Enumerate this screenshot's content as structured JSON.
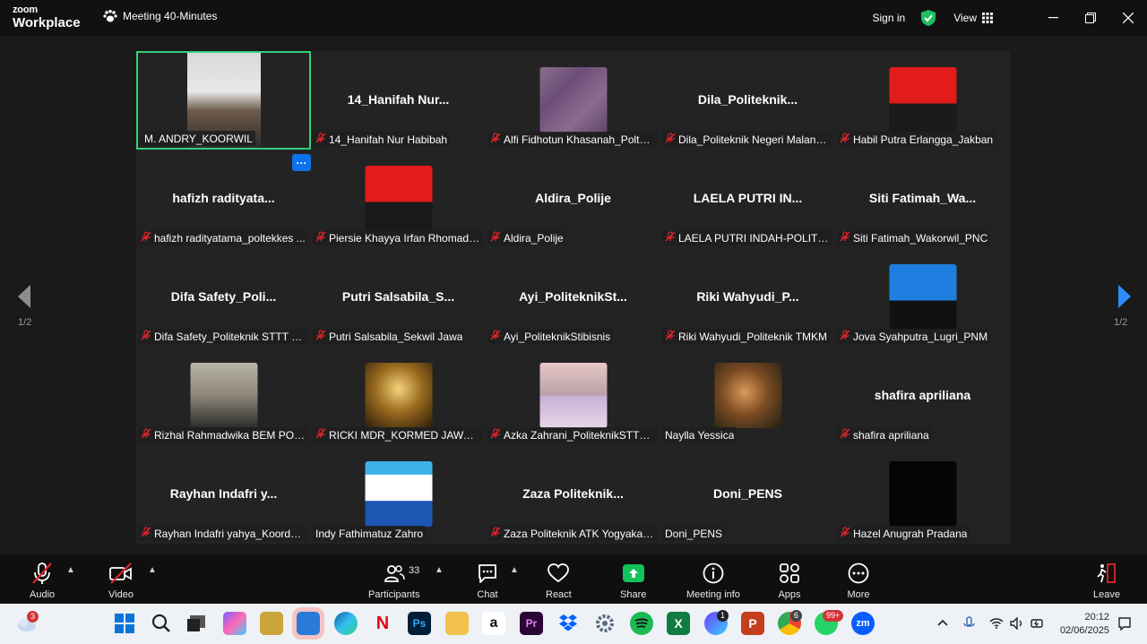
{
  "window": {
    "brand_line1": "zoom",
    "brand_line2": "Workplace",
    "meeting_title": "Meeting 40-Minutes",
    "signin_label": "Sign in",
    "view_label": "View"
  },
  "page_indicator": "1/2",
  "more_label": "···",
  "tiles": [
    {
      "label": "M. ANDRY_KOORWIL",
      "big": "",
      "muted": false,
      "active": true,
      "pic": "video"
    },
    {
      "label": "14_Hanifah Nur Habibah",
      "big": "14_Hanifah  Nur...",
      "muted": true,
      "pic": ""
    },
    {
      "label": "Alfi Fidhotun Khasanah_Poltek...",
      "big": "",
      "muted": true,
      "pic": "blur"
    },
    {
      "label": "Dila_Politeknik Negeri Malang...",
      "big": "Dila_Politeknik...",
      "muted": true,
      "pic": ""
    },
    {
      "label": "Habil Putra Erlangga_Jakban",
      "big": "",
      "muted": true,
      "pic": "red"
    },
    {
      "label": "hafizh radityatama_poltekkes ...",
      "big": "hafizh  radityata...",
      "muted": true,
      "pic": ""
    },
    {
      "label": "Piersie Khayya Irfan Rhomadh...",
      "big": "",
      "muted": true,
      "pic": "red"
    },
    {
      "label": "Aldira_Polije",
      "big": "Aldira_Polije",
      "muted": true,
      "pic": ""
    },
    {
      "label": "LAELA PUTRI INDAH-POLITEK...",
      "big": "LAELA PUTRI IN...",
      "muted": true,
      "pic": ""
    },
    {
      "label": "Siti Fatimah_Wakorwil_PNC",
      "big": "Siti  Fatimah_Wa...",
      "muted": true,
      "pic": ""
    },
    {
      "label": "Difa Safety_Politeknik STTT Ba...",
      "big": "Difa  Safety_Poli...",
      "muted": true,
      "pic": ""
    },
    {
      "label": "Putri Salsabila_Sekwil Jawa",
      "big": "Putri  Salsabila_S...",
      "muted": true,
      "pic": ""
    },
    {
      "label": "Ayi_PoliteknikStibisnis",
      "big": "Ayi_PoliteknikSt...",
      "muted": true,
      "pic": ""
    },
    {
      "label": "Riki Wahyudi_Politeknik TMKM",
      "big": "Riki  Wahyudi_P...",
      "muted": true,
      "pic": ""
    },
    {
      "label": "Jova Syahputra_Lugri_PNM",
      "big": "",
      "muted": true,
      "pic": "blue"
    },
    {
      "label": "Rizhal Rahmadwika BEM POLI...",
      "big": "",
      "muted": true,
      "pic": "room"
    },
    {
      "label": "RICKI MDR_KORMED JAWA_P...",
      "big": "",
      "muted": true,
      "pic": "gold"
    },
    {
      "label": "Azka Zahrani_PoliteknikSTTTB...",
      "big": "",
      "muted": true,
      "pic": "collage"
    },
    {
      "label": "Naylla Yessica",
      "big": "",
      "muted": false,
      "pic": "cat"
    },
    {
      "label": "shafira apriliana",
      "big": "shafira apriliana",
      "muted": true,
      "pic": ""
    },
    {
      "label": "Rayhan Indafri yahya_Koorda ...",
      "big": "Rayhan  Indafri  y...",
      "muted": true,
      "pic": ""
    },
    {
      "label": "Indy Fathimatuz Zahro",
      "big": "",
      "muted": false,
      "pic": "hijab"
    },
    {
      "label": "Zaza Politeknik ATK Yogyakarta",
      "big": "Zaza  Politeknik...",
      "muted": true,
      "pic": ""
    },
    {
      "label": "Doni_PENS",
      "big": "Doni_PENS",
      "muted": false,
      "pic": ""
    },
    {
      "label": "Hazel Anugrah Pradana",
      "big": "",
      "muted": true,
      "pic": "black"
    }
  ],
  "toolbar": {
    "audio": "Audio",
    "video": "Video",
    "participants": "Participants",
    "participants_count": "33",
    "chat": "Chat",
    "react": "React",
    "share": "Share",
    "meeting_info": "Meeting info",
    "apps": "Apps",
    "more": "More",
    "leave": "Leave"
  },
  "taskbar": {
    "weather_badge": "3",
    "edge_badge": "1",
    "chrome_badge": "6",
    "whatsapp_badge": "99+",
    "time": "20:12",
    "date": "02/06/2025"
  },
  "colors": {
    "accent_green": "#2fd17a",
    "zoom_blue": "#0e72ed",
    "muted_red": "#e0242b",
    "share_green": "#12c25b"
  }
}
